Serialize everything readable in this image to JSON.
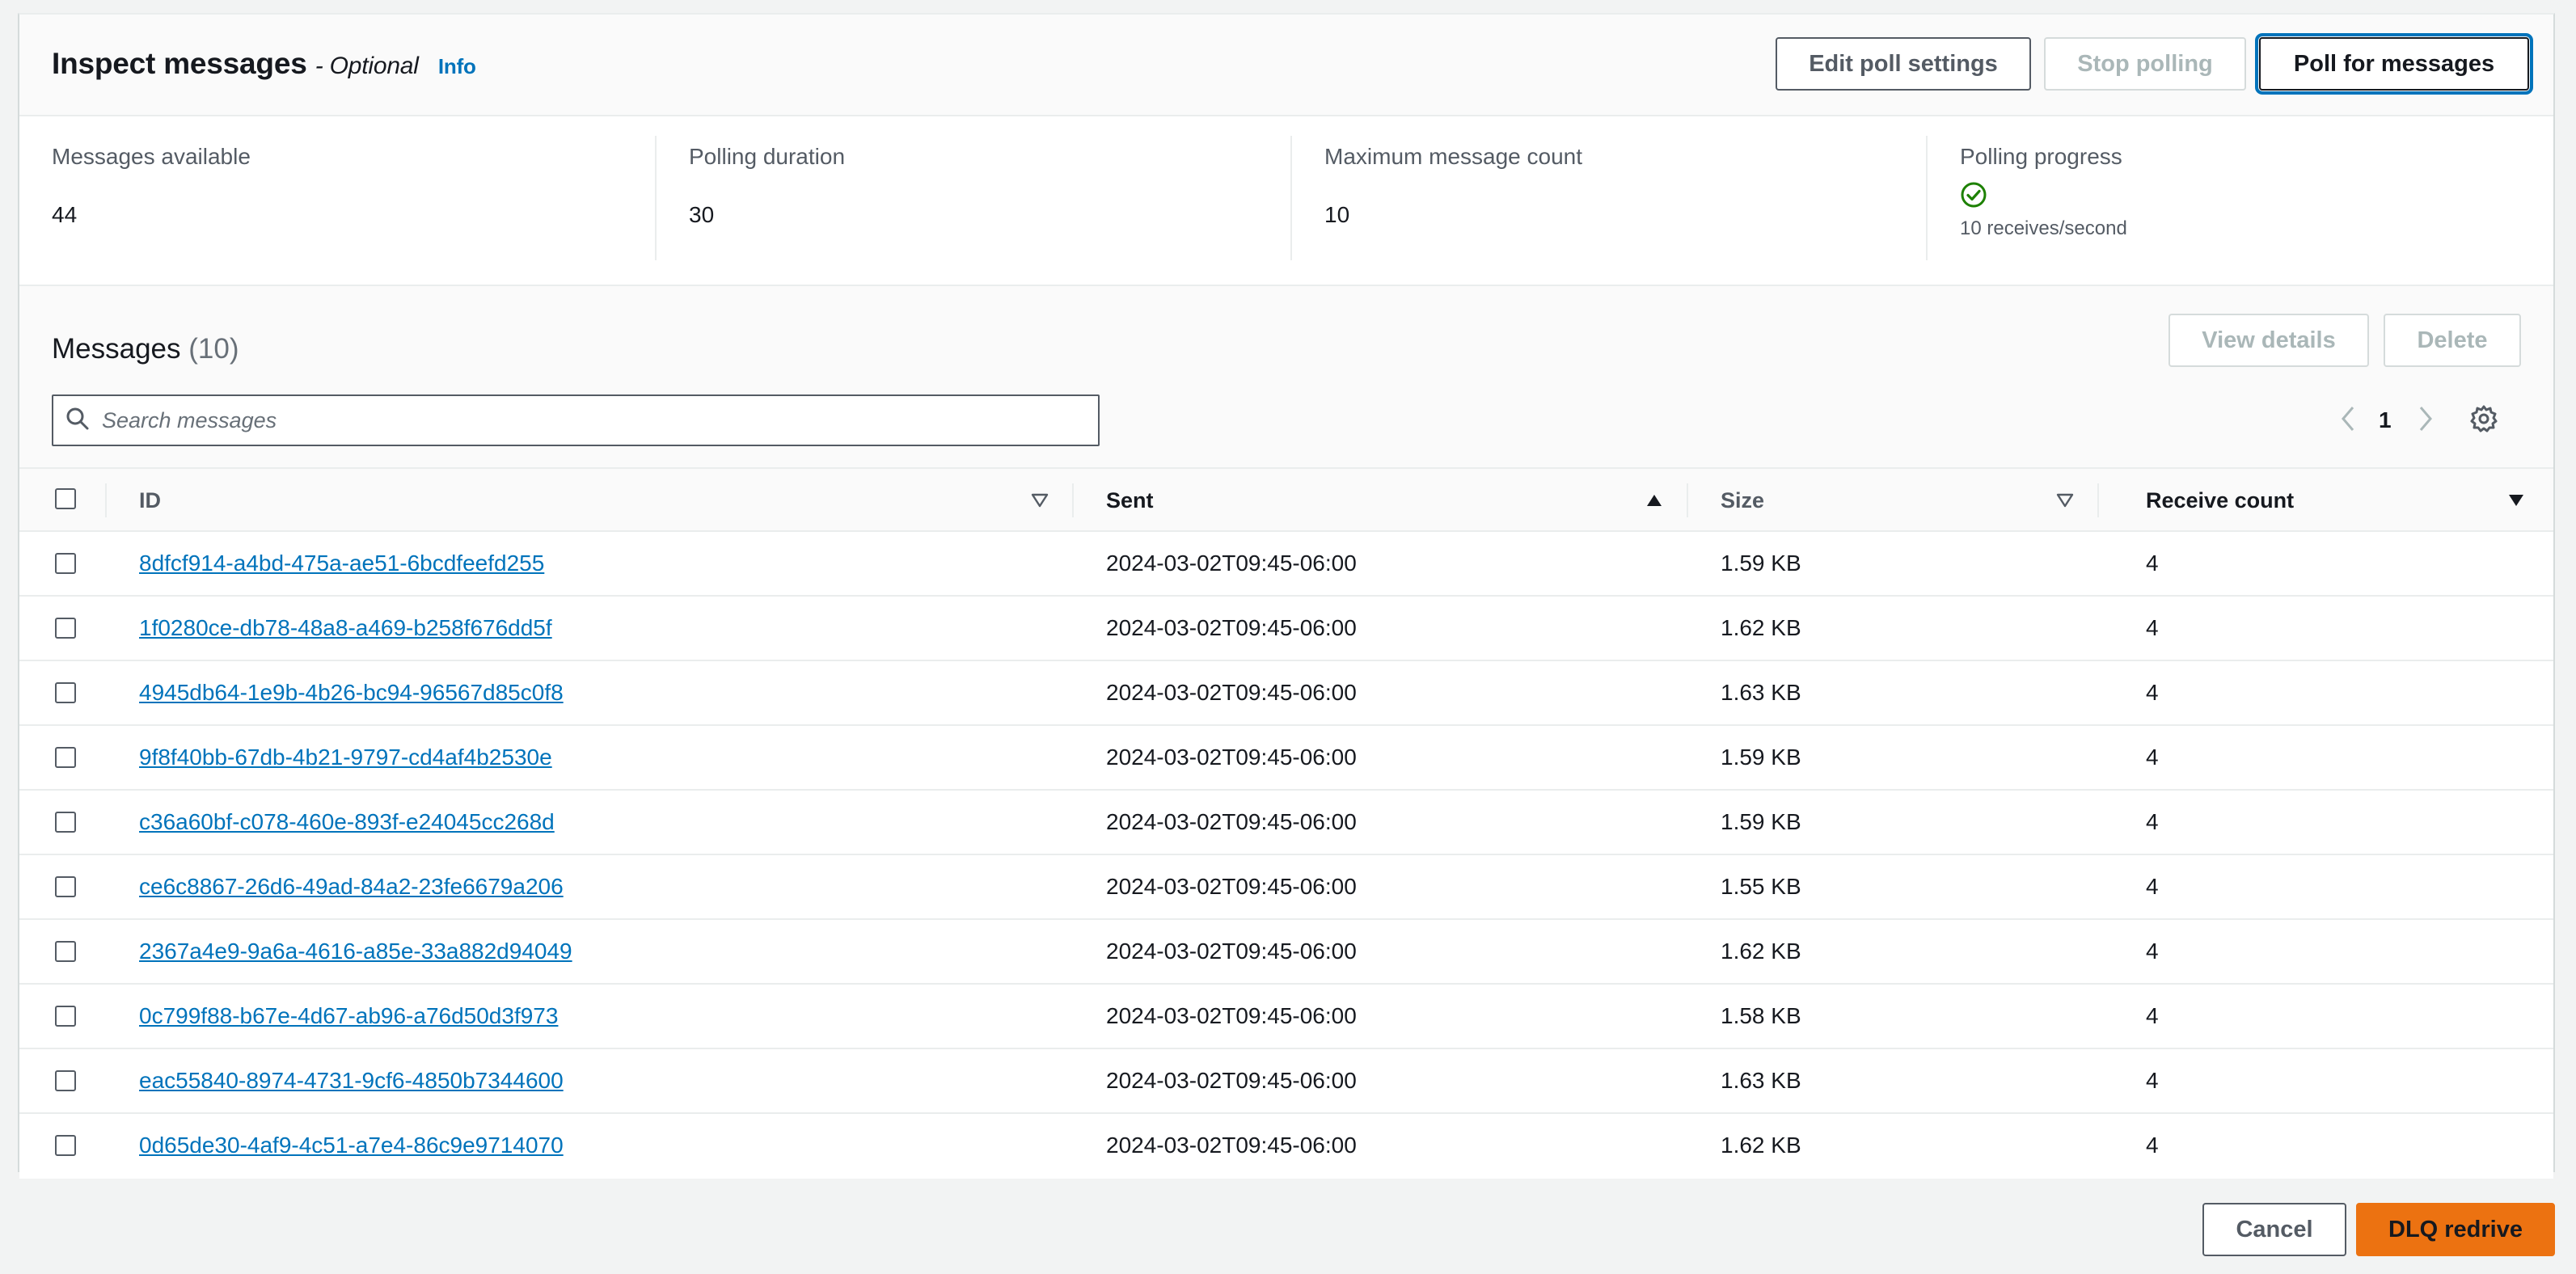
{
  "header": {
    "title": "Inspect messages",
    "optional": "- Optional",
    "info": "Info",
    "edit_poll_settings": "Edit poll settings",
    "stop_polling": "Stop polling",
    "poll_for_messages": "Poll for messages"
  },
  "stats": {
    "messages_available": {
      "label": "Messages available",
      "value": "44"
    },
    "polling_duration": {
      "label": "Polling duration",
      "value": "30"
    },
    "max_message_count": {
      "label": "Maximum message count",
      "value": "10"
    },
    "polling_progress": {
      "label": "Polling progress",
      "value": "10 receives/second",
      "status_icon": "check-circle-icon",
      "status_color": "#1d8102"
    }
  },
  "messages": {
    "title": "Messages",
    "count": "(10)",
    "view_details": "View details",
    "delete": "Delete",
    "search_placeholder": "Search messages",
    "page": "1",
    "columns": {
      "id": "ID",
      "sent": "Sent",
      "size": "Size",
      "receive_count": "Receive count"
    },
    "rows": [
      {
        "id": "8dfcf914-a4bd-475a-ae51-6bcdfeefd255",
        "sent": "2024-03-02T09:45-06:00",
        "size": "1.59 KB",
        "receive_count": "4"
      },
      {
        "id": "1f0280ce-db78-48a8-a469-b258f676dd5f",
        "sent": "2024-03-02T09:45-06:00",
        "size": "1.62 KB",
        "receive_count": "4"
      },
      {
        "id": "4945db64-1e9b-4b26-bc94-96567d85c0f8",
        "sent": "2024-03-02T09:45-06:00",
        "size": "1.63 KB",
        "receive_count": "4"
      },
      {
        "id": "9f8f40bb-67db-4b21-9797-cd4af4b2530e",
        "sent": "2024-03-02T09:45-06:00",
        "size": "1.59 KB",
        "receive_count": "4"
      },
      {
        "id": "c36a60bf-c078-460e-893f-e24045cc268d",
        "sent": "2024-03-02T09:45-06:00",
        "size": "1.59 KB",
        "receive_count": "4"
      },
      {
        "id": "ce6c8867-26d6-49ad-84a2-23fe6679a206",
        "sent": "2024-03-02T09:45-06:00",
        "size": "1.55 KB",
        "receive_count": "4"
      },
      {
        "id": "2367a4e9-9a6a-4616-a85e-33a882d94049",
        "sent": "2024-03-02T09:45-06:00",
        "size": "1.62 KB",
        "receive_count": "4"
      },
      {
        "id": "0c799f88-b67e-4d67-ab96-a76d50d3f973",
        "sent": "2024-03-02T09:45-06:00",
        "size": "1.58 KB",
        "receive_count": "4"
      },
      {
        "id": "eac55840-8974-4731-9cf6-4850b7344600",
        "sent": "2024-03-02T09:45-06:00",
        "size": "1.63 KB",
        "receive_count": "4"
      },
      {
        "id": "0d65de30-4af9-4c51-a7e4-86c9e9714070",
        "sent": "2024-03-02T09:45-06:00",
        "size": "1.62 KB",
        "receive_count": "4"
      }
    ]
  },
  "footer": {
    "cancel": "Cancel",
    "dlq_redrive": "DLQ redrive"
  },
  "colors": {
    "link": "#0073bb",
    "primary": "#ec7211",
    "success": "#1d8102"
  }
}
